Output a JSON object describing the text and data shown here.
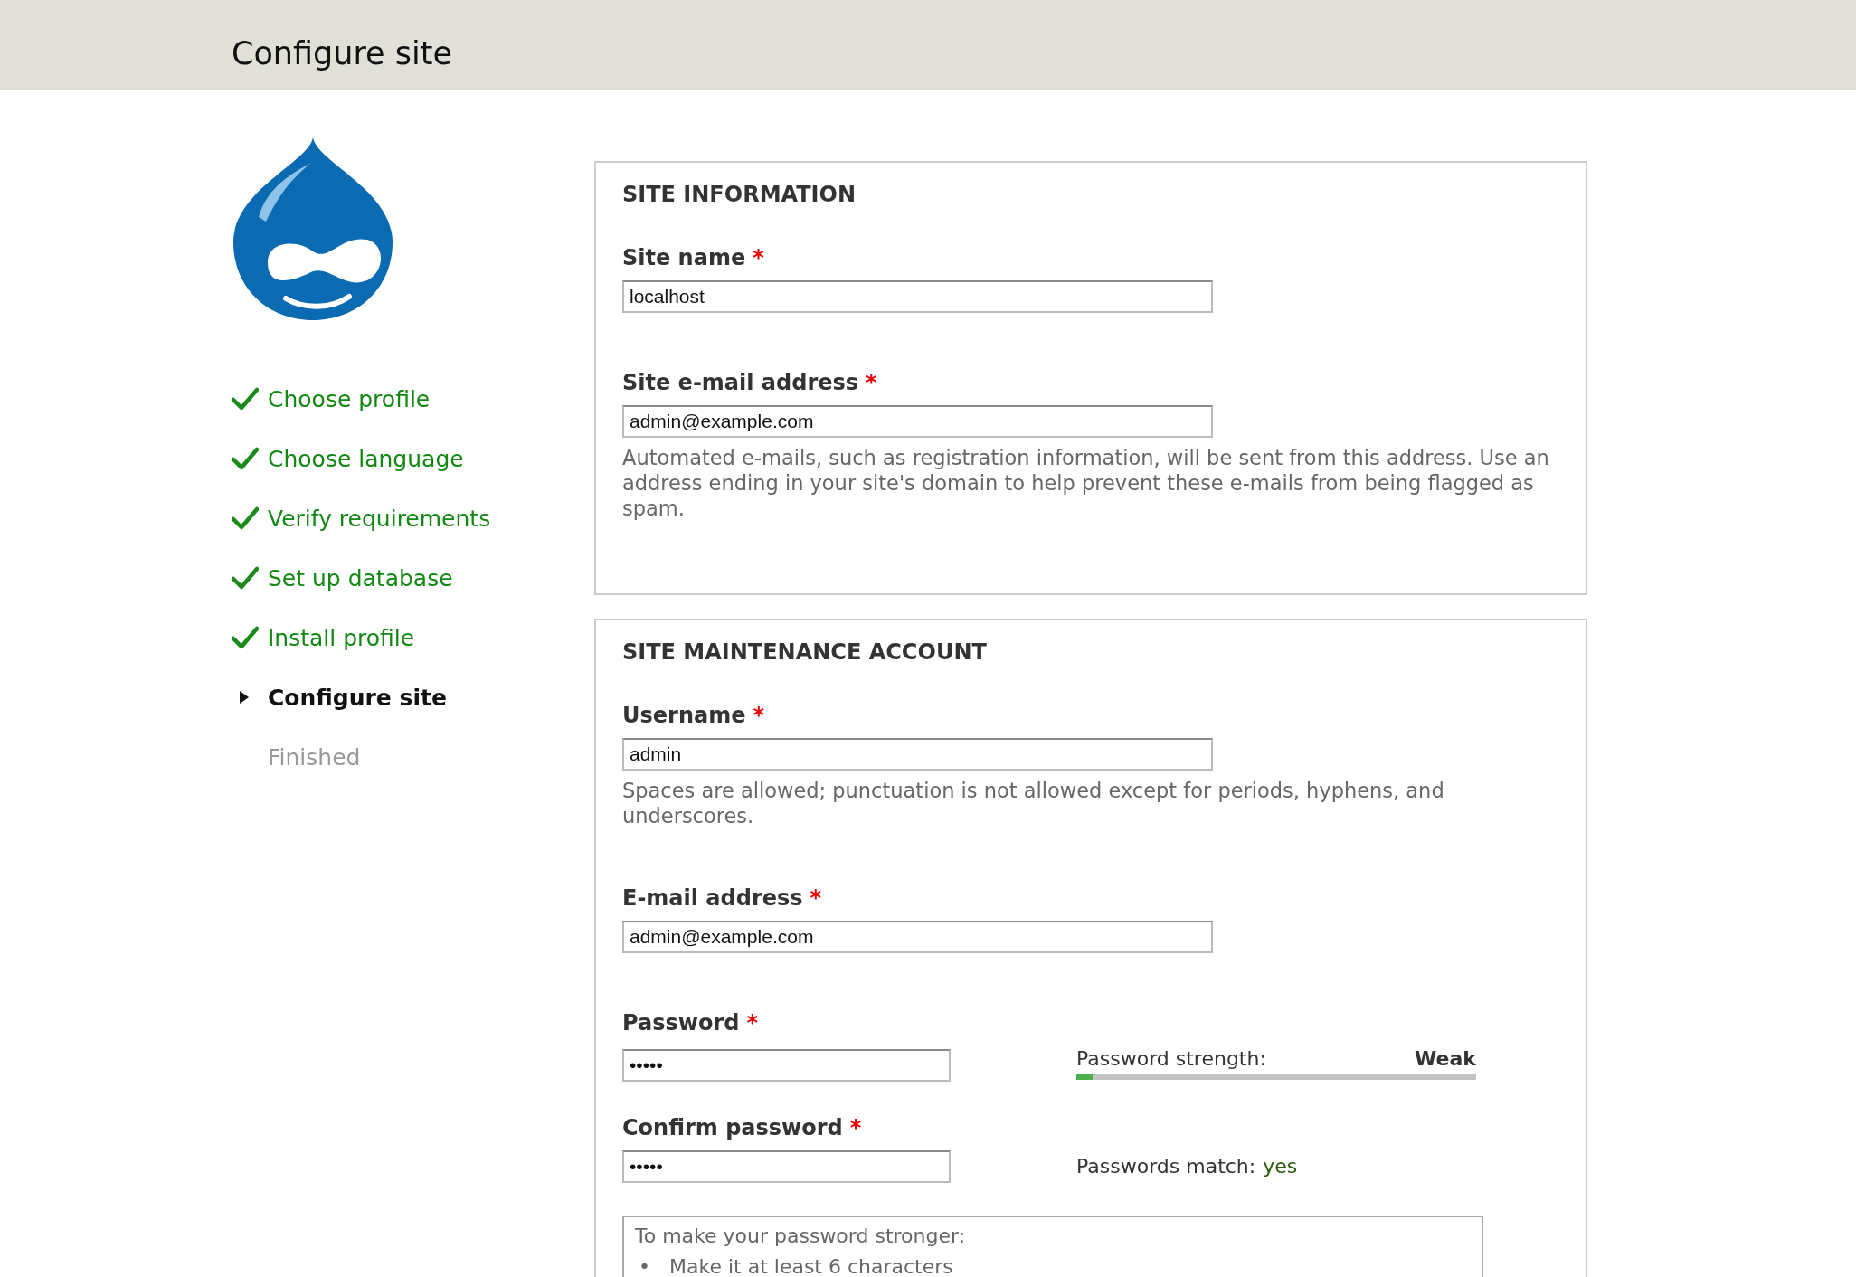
{
  "header": {
    "title": "Configure site"
  },
  "steps": [
    {
      "label": "Choose profile",
      "completed": true,
      "selected": false
    },
    {
      "label": "Choose language",
      "completed": true,
      "selected": false
    },
    {
      "label": "Verify requirements",
      "completed": true,
      "selected": false
    },
    {
      "label": "Set up database",
      "completed": true,
      "selected": false
    },
    {
      "label": "Install profile",
      "completed": true,
      "selected": false
    },
    {
      "label": "Configure site",
      "completed": false,
      "selected": true
    },
    {
      "label": "Finished",
      "completed": false,
      "selected": false
    }
  ],
  "required_mark": "*",
  "sections": [
    {
      "legend": "SITE INFORMATION",
      "fields": [
        {
          "kind": "text",
          "label": "Site name",
          "required": true,
          "value": "localhost"
        },
        {
          "kind": "text",
          "label": "Site e-mail address",
          "required": true,
          "value": "admin@example.com",
          "description": "Automated e-mails, such as registration information, will be sent from this address. Use an address ending in your site's domain to help prevent these e-mails from being flagged as spam."
        }
      ]
    },
    {
      "legend": "SITE MAINTENANCE ACCOUNT",
      "fields": [
        {
          "kind": "text",
          "label": "Username",
          "required": true,
          "value": "admin",
          "description": "Spaces are allowed; punctuation is not allowed except for periods, hyphens, and underscores."
        },
        {
          "kind": "text",
          "label": "E-mail address",
          "required": true,
          "value": "admin@example.com"
        },
        {
          "kind": "password",
          "label": "Password",
          "required": true,
          "value": "•••••",
          "strength": {
            "label": "Password strength:",
            "rating": "Weak",
            "level": 0.04
          }
        },
        {
          "kind": "confirm",
          "label": "Confirm password",
          "required": true,
          "value": "•••••",
          "match": {
            "label": "Passwords match:",
            "result": "yes"
          }
        }
      ],
      "suggestions": {
        "title": "To make your password stronger:",
        "bullet": "•",
        "items": [
          "Make it at least 6 characters"
        ]
      }
    }
  ]
}
